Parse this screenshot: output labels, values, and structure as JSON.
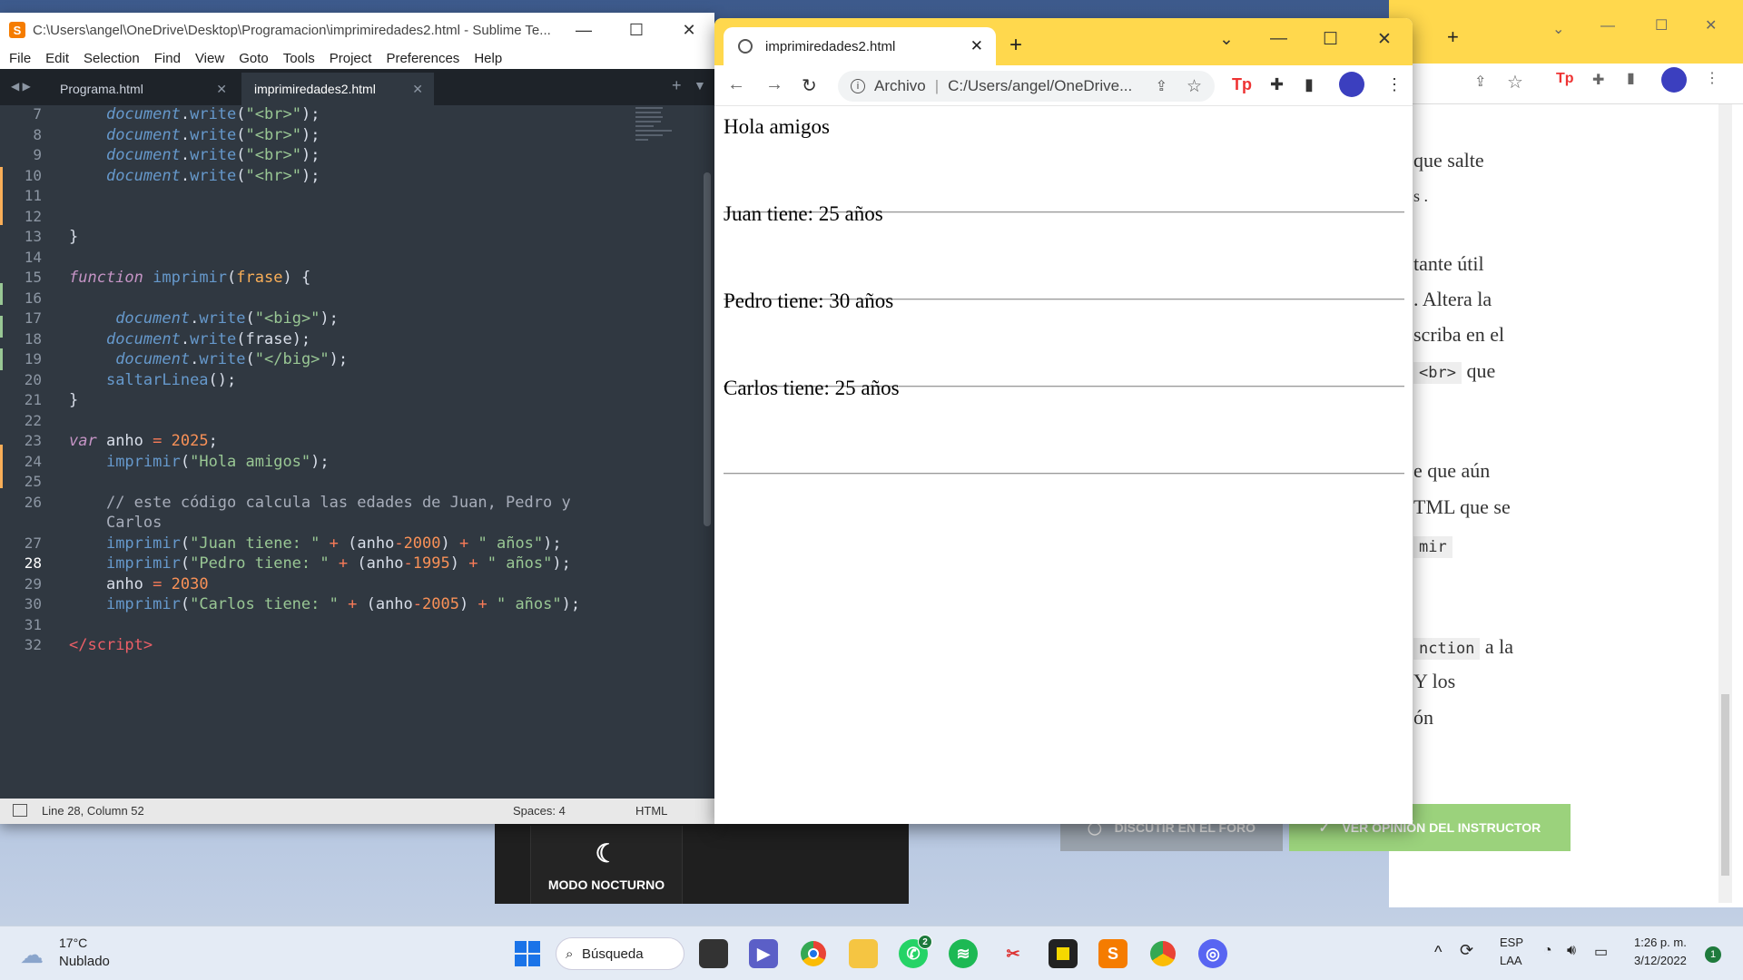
{
  "sublime": {
    "title": "C:\\Users\\angel\\OneDrive\\Desktop\\Programacion\\imprimiredades2.html - Sublime Te...",
    "menu": [
      "File",
      "Edit",
      "Selection",
      "Find",
      "View",
      "Goto",
      "Tools",
      "Project",
      "Preferences",
      "Help"
    ],
    "tabs": [
      {
        "label": "Programa.html"
      },
      {
        "label": "imprimiredades2.html"
      }
    ],
    "status": {
      "position": "Line 28, Column 52",
      "spaces": "Spaces: 4",
      "syntax": "HTML"
    },
    "line_numbers": [
      "7",
      "8",
      "9",
      "10",
      "11",
      "12",
      "13",
      "14",
      "15",
      "16",
      "17",
      "18",
      "19",
      "20",
      "21",
      "22",
      "23",
      "24",
      "25",
      "26",
      "",
      "27",
      "28",
      "29",
      "30",
      "31",
      "32"
    ]
  },
  "chrome": {
    "tab_title": "imprimiredades2.html",
    "address_prefix": "Archivo",
    "address": "C:/Users/angel/OneDrive...",
    "page_lines": [
      "Hola amigos",
      "Juan tiene: 25 años",
      "Pedro tiene: 30 años",
      "Carlos tiene: 25 años"
    ]
  },
  "background_page": {
    "lines": [
      "que salte",
      "s .",
      "tante útil",
      ". Altera la",
      "scriba en el",
      "que",
      "e que aún",
      "TML que se",
      "a la",
      "Y los",
      "ón"
    ],
    "codes": [
      "<br>",
      "mir",
      "nction"
    ],
    "buttons": {
      "forum": "DISCUTIR EN EL FORO",
      "instructor": "VER OPINIÓN DEL INSTRUCTOR"
    },
    "night_mode": "MODO NOCTURNO"
  },
  "taskbar": {
    "weather_temp": "17°C",
    "weather_desc": "Nublado",
    "search_label": "Búsqueda",
    "lang1": "ESP",
    "lang2": "LAA",
    "time": "1:26 p. m.",
    "date": "3/12/2022",
    "notif_count": "1",
    "whatsapp_badge": "2"
  },
  "colors": {
    "chrome_accent": "#ffd84d",
    "editor_bg": "#303841",
    "taskbar_bg": "#e4ebf5"
  }
}
